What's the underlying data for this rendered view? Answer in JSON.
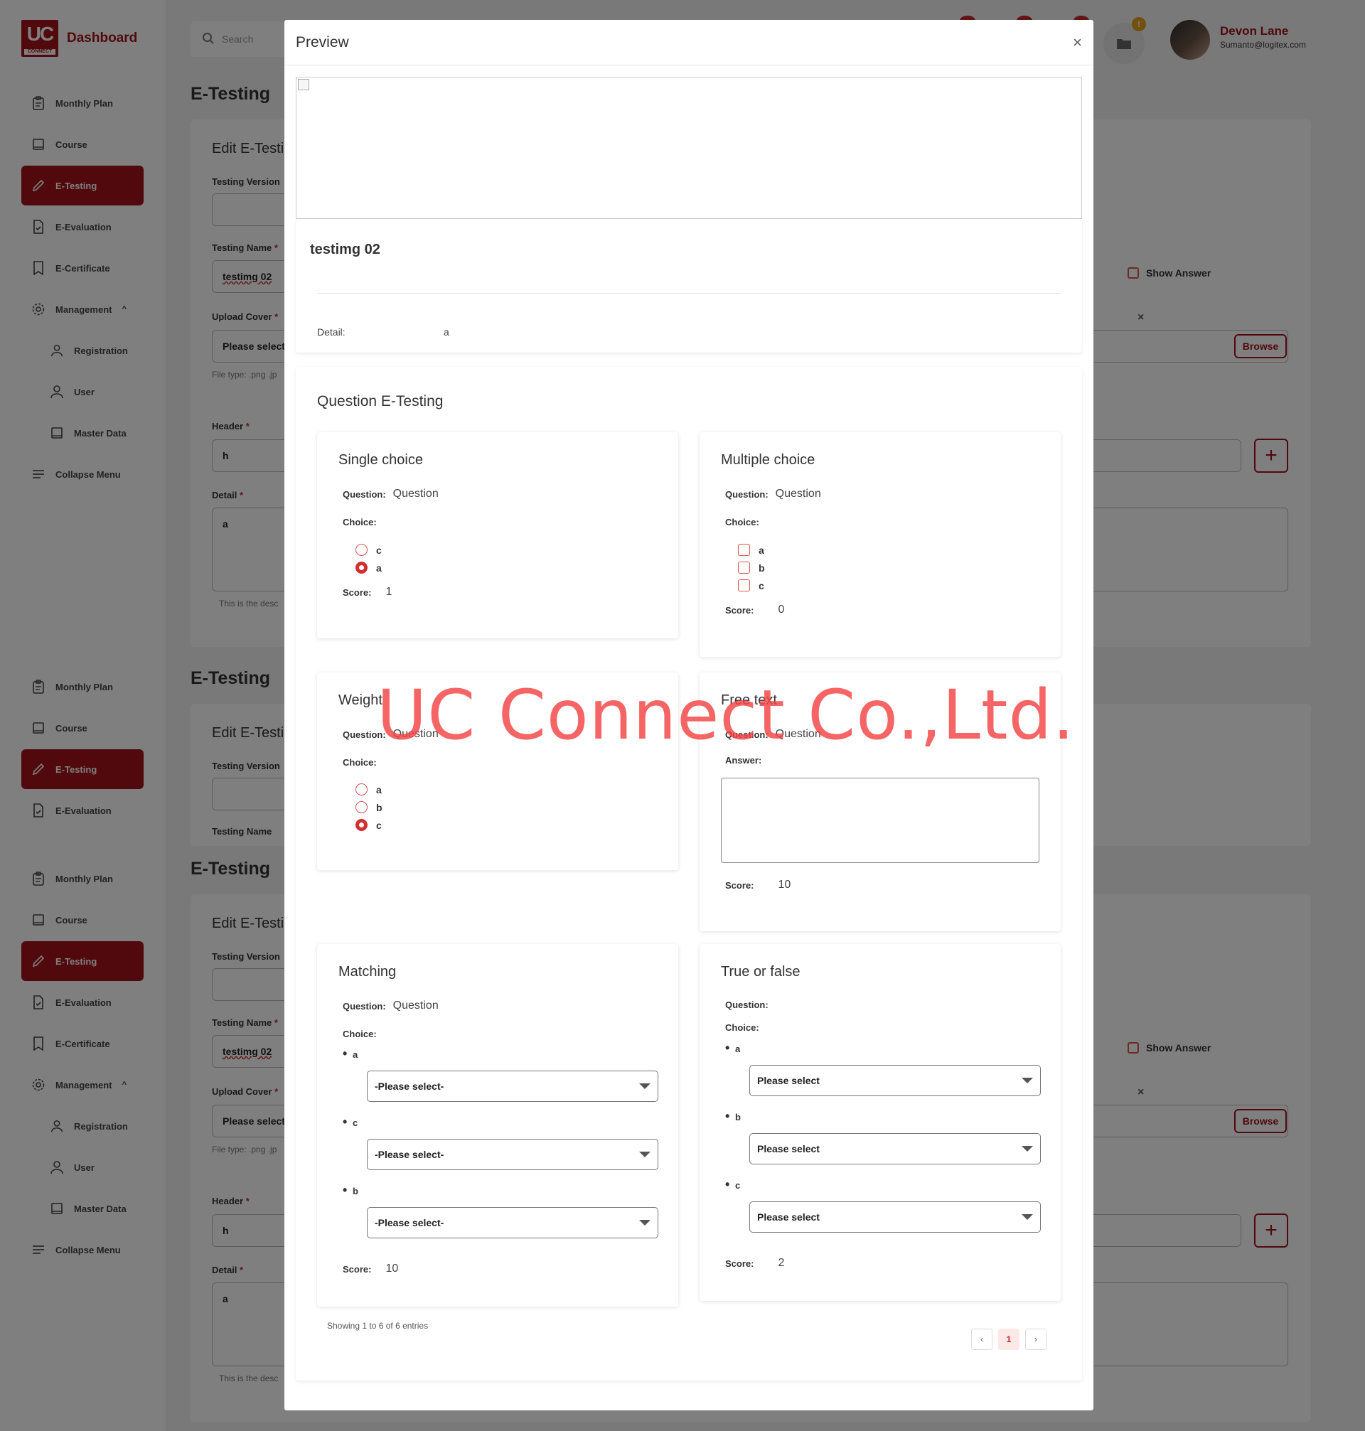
{
  "app": {
    "brand": "Dashboard",
    "logo_text": "UC",
    "logo_sub": "CONNECT"
  },
  "topbar": {
    "search_placeholder": "Search",
    "folder_badge": "!",
    "user_name": "Devon Lane",
    "user_email": "Sumanto@logitex.com"
  },
  "sidebar_blocks": [
    {
      "items": [
        {
          "label": "Monthly Plan",
          "icon": "clipboard-icon"
        },
        {
          "label": "Course",
          "icon": "book-icon"
        },
        {
          "label": "E-Testing",
          "icon": "pencil-icon",
          "active": true
        },
        {
          "label": "E-Evaluation",
          "icon": "file-check-icon"
        },
        {
          "label": "E-Certificate",
          "icon": "bookmark-icon"
        },
        {
          "label": "Management",
          "icon": "gear-icon",
          "expand": "^"
        },
        {
          "label": "Registration",
          "icon": "users-icon",
          "sub": true
        },
        {
          "label": "User",
          "icon": "user-icon",
          "sub": true
        },
        {
          "label": "Master Data",
          "icon": "book-icon",
          "sub": true
        },
        {
          "label": "Collapse Menu",
          "icon": "menu-icon"
        }
      ]
    },
    {
      "items": [
        {
          "label": "Monthly Plan",
          "icon": "clipboard-icon"
        },
        {
          "label": "Course",
          "icon": "book-icon"
        },
        {
          "label": "E-Testing",
          "icon": "pencil-icon",
          "active": true
        },
        {
          "label": "E-Evaluation",
          "icon": "file-check-icon"
        }
      ]
    },
    {
      "items": [
        {
          "label": "Monthly Plan",
          "icon": "clipboard-icon"
        },
        {
          "label": "Course",
          "icon": "book-icon"
        },
        {
          "label": "E-Testing",
          "icon": "pencil-icon",
          "active": true
        },
        {
          "label": "E-Evaluation",
          "icon": "file-check-icon"
        },
        {
          "label": "E-Certificate",
          "icon": "bookmark-icon"
        },
        {
          "label": "Management",
          "icon": "gear-icon",
          "expand": "^"
        },
        {
          "label": "Registration",
          "icon": "users-icon",
          "sub": true
        },
        {
          "label": "User",
          "icon": "user-icon",
          "sub": true
        },
        {
          "label": "Master Data",
          "icon": "book-icon",
          "sub": true
        },
        {
          "label": "Collapse Menu",
          "icon": "menu-icon"
        }
      ]
    }
  ],
  "bg_page": {
    "heading": "E-Testing",
    "card_title": "Edit E-Testi",
    "testing_version_label": "Testing Version",
    "testing_name_label": "Testing Name",
    "testing_name_value": "testimg 02",
    "upload_cover_label": "Upload Cover",
    "upload_cover_placeholder": "Please select",
    "file_type_hint": "File type: .png .jp",
    "header_label": "Header",
    "header_value": "h",
    "detail_label": "Detail",
    "detail_value": "a",
    "desc_hint": "This is the desc",
    "show_answer": "Show Answer",
    "browse": "Browse",
    "required_mark": "*",
    "plus": "+",
    "close_x": "×"
  },
  "modal": {
    "title": "Preview",
    "close": "×",
    "testing_name": "testimg 02",
    "detail_label": "Detail:",
    "detail_value": "a",
    "section_title": "Question E-Testing",
    "labels": {
      "question": "Question:",
      "choice": "Choice:",
      "score": "Score:",
      "answer": "Answer:"
    },
    "questions": [
      {
        "type": "Single choice",
        "question": "Question",
        "choices": [
          {
            "label": "c",
            "selected": false
          },
          {
            "label": "a",
            "selected": true
          }
        ],
        "score": "1"
      },
      {
        "type": "Multiple choice",
        "question": "Question",
        "choices": [
          {
            "label": "a",
            "checked": false
          },
          {
            "label": "b",
            "checked": false
          },
          {
            "label": "c",
            "checked": false
          }
        ],
        "score": "0"
      },
      {
        "type": "Weight",
        "question": "Question",
        "choices": [
          {
            "label": "a",
            "selected": false
          },
          {
            "label": "b",
            "selected": false
          },
          {
            "label": "c",
            "selected": true
          }
        ]
      },
      {
        "type": "Free text",
        "question": "Question",
        "answer": "",
        "score": "10"
      },
      {
        "type": "Matching",
        "question": "Question",
        "items": [
          {
            "label": "a",
            "select": "-Please select-"
          },
          {
            "label": "c",
            "select": "-Please select-"
          },
          {
            "label": "b",
            "select": "-Please select-"
          }
        ],
        "score": "10"
      },
      {
        "type": "True or false",
        "question": "",
        "items": [
          {
            "label": "a",
            "select": "Please select"
          },
          {
            "label": "b",
            "select": "Please select"
          },
          {
            "label": "c",
            "select": "Please select"
          }
        ],
        "score": "2"
      }
    ],
    "entries_text": "Showing 1 to 6 of 6 entries",
    "pagination": {
      "prev": "‹",
      "current": "1",
      "next": "›"
    }
  },
  "watermark": "UC Connect Co.,Ltd."
}
